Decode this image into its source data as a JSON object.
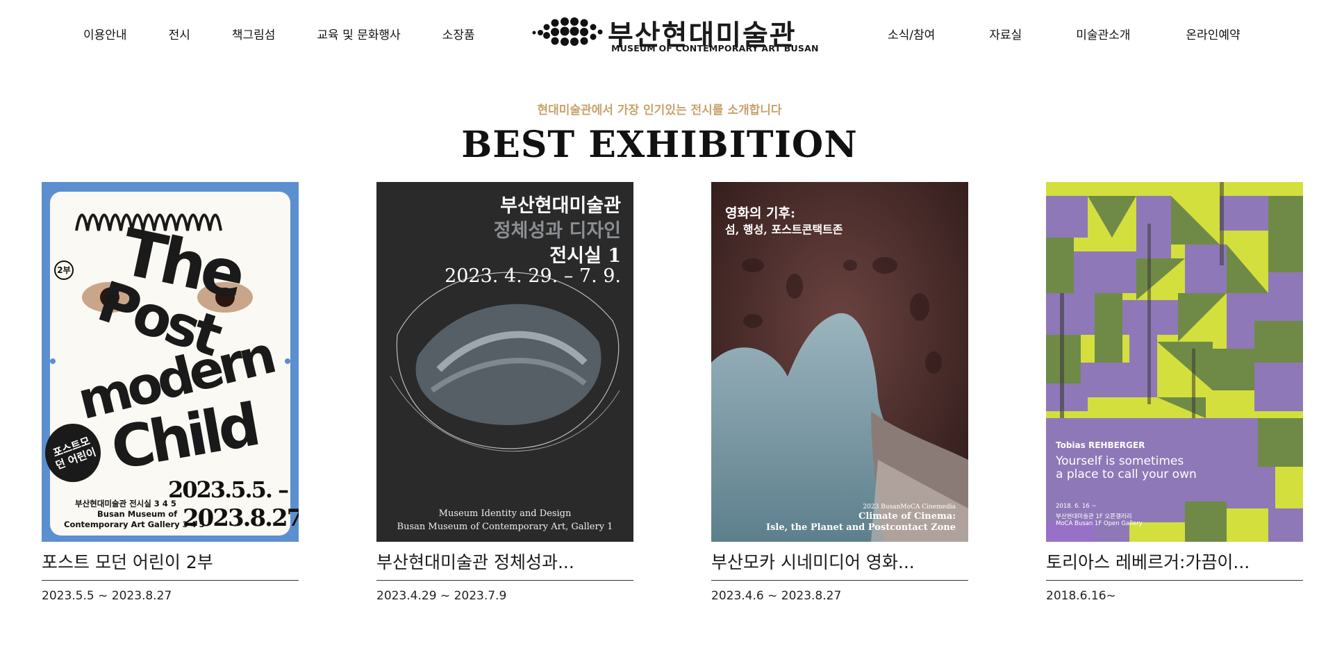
{
  "nav": {
    "left": [
      "이용안내",
      "전시",
      "책그림섬",
      "교육 및 문화행사",
      "소장품"
    ],
    "right": [
      "소식/참여",
      "자료실",
      "미술관소개",
      "온라인예약"
    ]
  },
  "logo": {
    "name_ko": "부산현대미술관",
    "name_en": "MUSEUM OF CONTEMPORARY ART BUSAN",
    "icon": "dots-logo-icon"
  },
  "section": {
    "subtitle": "현대미술관에서 가장 인기있는 전시를 소개합니다",
    "title": "BEST EXHIBITION"
  },
  "exhibitions": [
    {
      "title": "포스트 모던 어린이 2부",
      "date": "2023.5.5 ~ 2023.8.27",
      "poster": {
        "bg": "#5b8fd0",
        "headline": [
          "The",
          "Post",
          "modern",
          "Child"
        ],
        "badge": "2부",
        "side_label": "포스트모던 어린이",
        "dates": [
          "2023.5.5. –",
          "2023.8.27."
        ],
        "venue_ko": "부산현대미술관 전시실 3 4 5",
        "venue_en": [
          "Busan Museum of",
          "Contemporary Art Gallery 3 4 5"
        ]
      }
    },
    {
      "title": "부산현대미술관 정체성과...",
      "date": "2023.4.29 ~ 2023.7.9",
      "poster": {
        "bg": "#2a2a2a",
        "heading": [
          "부산현대미술관",
          "정체성과 디자인",
          "전시실 1"
        ],
        "dates": "2023. 4. 29. – 7. 9.",
        "footer": [
          "Museum Identity and Design",
          "Busan Museum of Contemporary Art, Gallery 1"
        ]
      }
    },
    {
      "title": "부산모카 시네미디어 영화...",
      "date": "2023.4.6 ~ 2023.8.27",
      "poster": {
        "bg": "#4a2e2c",
        "heading": [
          "영화의 기후:",
          "섬, 행성, 포스트콘택트존"
        ],
        "footer": [
          "2023 BusanMoCA Cinemedia",
          "Climate of Cinema:",
          "Isle, the Planet and Postcontact Zone"
        ]
      }
    },
    {
      "title": "토리아스 레베르거:가끔이...",
      "date": "2018.6.16~",
      "poster": {
        "bg": "#c9d83f",
        "artist": "Tobias REHBERGER",
        "tagline": [
          "Yourself is sometimes",
          "a place to call your own"
        ],
        "footer": [
          "2018. 6. 16 ~",
          "부산현대미술관 1F 오픈갤러리",
          "MoCA Busan 1F Open Gallery"
        ]
      }
    }
  ],
  "colors": {
    "accent": "#c8a26d",
    "text": "#111111"
  }
}
